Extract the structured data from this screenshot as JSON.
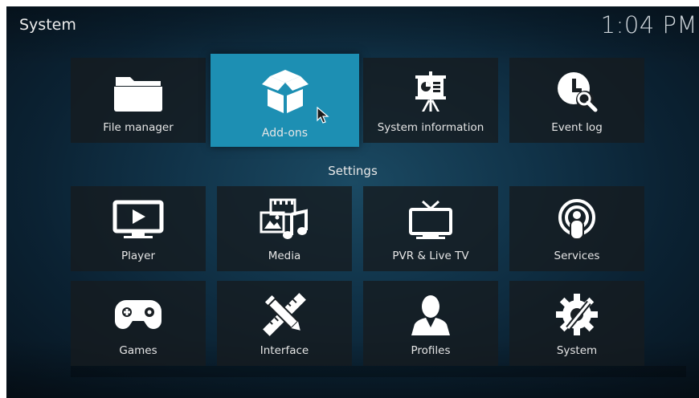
{
  "header": {
    "title": "System",
    "clock": "1:04 PM"
  },
  "top_row": [
    {
      "label": "File manager",
      "icon": "folder-icon"
    },
    {
      "label": "Add-ons",
      "icon": "box-icon",
      "focused": true
    },
    {
      "label": "System information",
      "icon": "presentation-icon"
    },
    {
      "label": "Event log",
      "icon": "clock-search-icon"
    }
  ],
  "settings": {
    "section_label": "Settings",
    "items": [
      {
        "label": "Player",
        "icon": "play-screen-icon"
      },
      {
        "label": "Media",
        "icon": "media-icon"
      },
      {
        "label": "PVR & Live TV",
        "icon": "tv-icon"
      },
      {
        "label": "Services",
        "icon": "podcast-icon"
      },
      {
        "label": "Games",
        "icon": "gamepad-icon"
      },
      {
        "label": "Interface",
        "icon": "pencil-ruler-icon"
      },
      {
        "label": "Profiles",
        "icon": "user-icon"
      },
      {
        "label": "System",
        "icon": "gears-icon"
      }
    ]
  },
  "colors": {
    "focus": "#1d8fb3",
    "tile_bg": "#161b1f",
    "text": "#e6e6e6"
  }
}
